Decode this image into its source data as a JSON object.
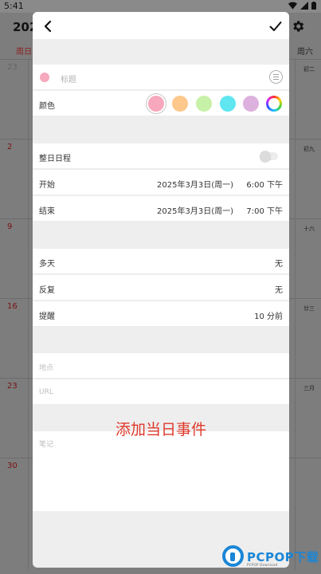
{
  "status_bar": {
    "time": "5:41"
  },
  "background_calendar": {
    "year_partial": "202",
    "weekday_sun": "周日",
    "weekday_sat": "周六",
    "rows": [
      {
        "day": "23",
        "lunar": "初二",
        "gray": true
      },
      {
        "day": "2",
        "lunar": "初九",
        "gray": false
      },
      {
        "day": "9",
        "lunar": "十六",
        "gray": false
      },
      {
        "day": "16",
        "lunar": "廿三",
        "gray": false
      },
      {
        "day": "23",
        "lunar": "三月",
        "gray": false
      },
      {
        "day": "30",
        "lunar": "",
        "gray": false
      }
    ]
  },
  "dialog": {
    "title_placeholder": "标题",
    "color_label": "颜色",
    "colors": [
      "#f7a8bc",
      "#fdc88c",
      "#c8f1a8",
      "#5fe6f1",
      "#ddb1dd"
    ],
    "selected_color": "#f7a8bc",
    "all_day_label": "整日日程",
    "all_day_on": false,
    "start_label": "开始",
    "start_date": "2025年3月3日(周一)",
    "start_time": "6:00 下午",
    "end_label": "结束",
    "end_date": "2025年3月3日(周一)",
    "end_time": "7:00 下午",
    "multi_day_label": "多天",
    "multi_day_value": "无",
    "repeat_label": "反复",
    "repeat_value": "无",
    "reminder_label": "提醒",
    "reminder_value": "10 分前",
    "location_placeholder": "地点",
    "url_placeholder": "URL",
    "notes_placeholder": "笔记"
  },
  "watermark_caption": "添加当日事件",
  "logo": {
    "text": "PCPOP下载",
    "sub": "PCPOP Download"
  }
}
